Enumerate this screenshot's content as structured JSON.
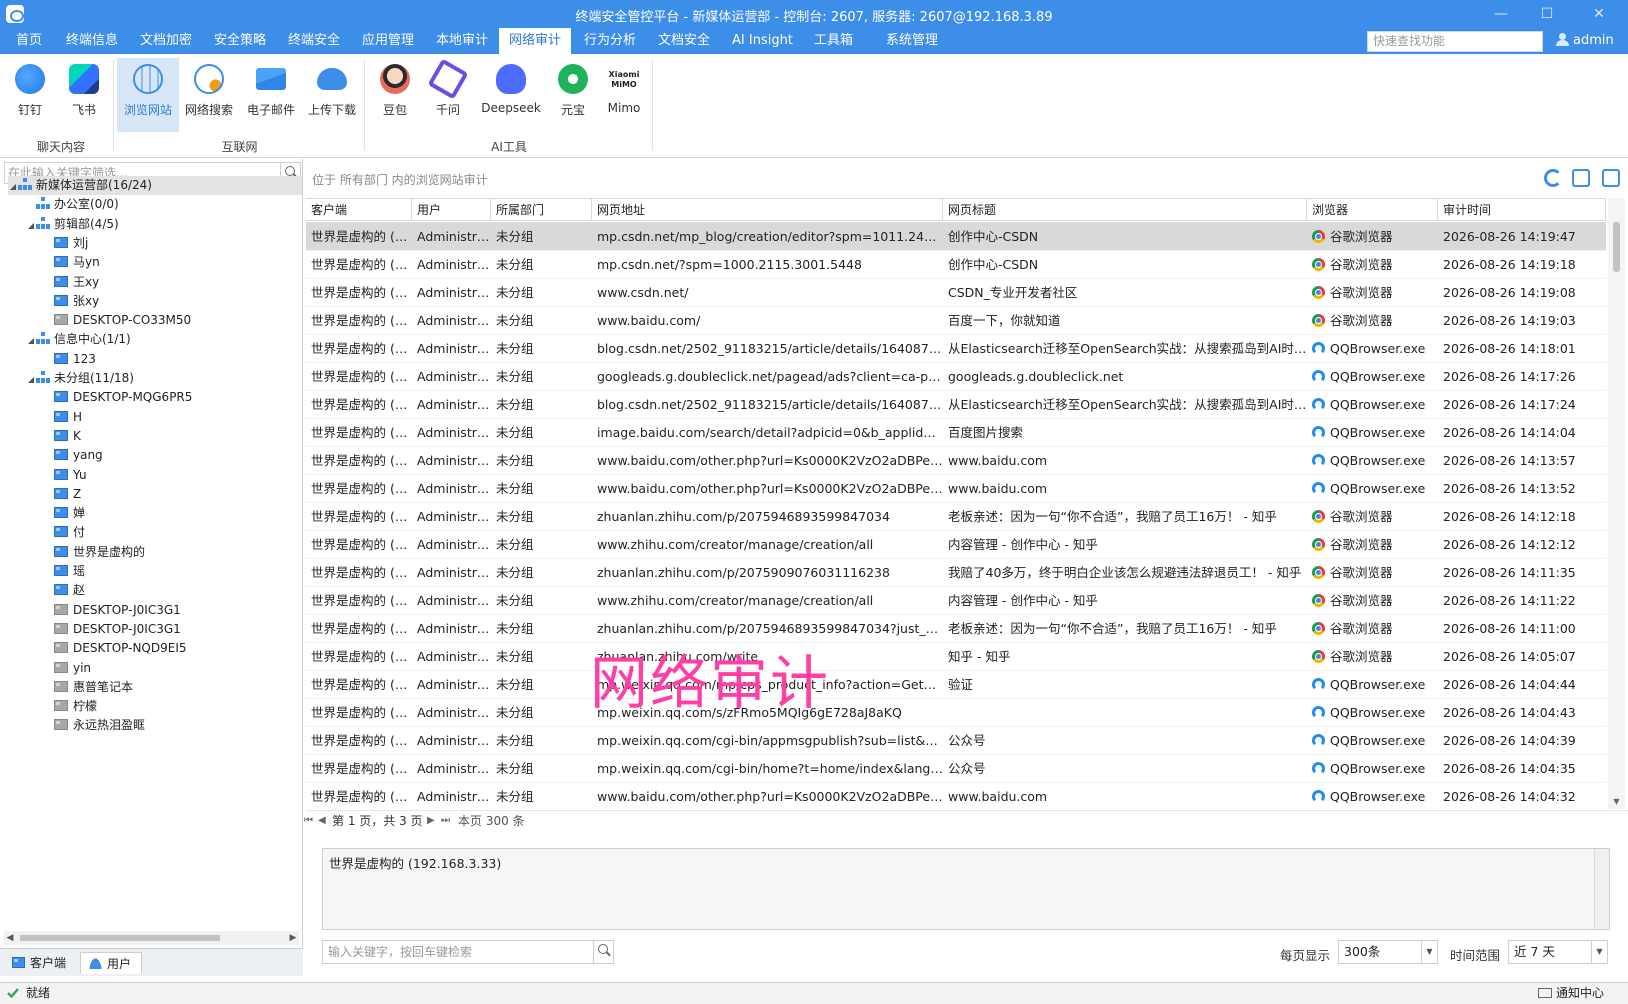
{
  "window": {
    "title": "终端安全管控平台 - 新媒体运营部 - 控制台: 2607, 服务器: 2607@192.168.3.89",
    "minimize": "—",
    "maximize": "☐",
    "close": "✕"
  },
  "menu": {
    "items": [
      "首页",
      "终端信息",
      "文档加密",
      "安全策略",
      "终端安全",
      "应用管理",
      "本地审计",
      "网络审计",
      "行为分析",
      "文档安全",
      "AI Insight",
      "工具箱",
      "系统管理"
    ],
    "active_index": 7,
    "quick_search_placeholder": "快速查找功能",
    "user": "admin"
  },
  "ribbon": {
    "groups": [
      {
        "label": "聊天内容",
        "buttons": [
          "钉钉",
          "飞书"
        ]
      },
      {
        "label": "互联网",
        "buttons": [
          "浏览网站",
          "网络搜索",
          "电子邮件",
          "上传下载"
        ]
      },
      {
        "label": "AI工具",
        "buttons": [
          "豆包",
          "千问",
          "Deepseek",
          "元宝",
          "Mimo"
        ]
      }
    ],
    "active_button": "浏览网站",
    "mimo_logo_text": [
      "Xiaomi",
      "MiMO"
    ]
  },
  "tree": {
    "filter_placeholder": "在此输入关键字筛选...",
    "nodes": [
      {
        "label": "新媒体运营部(16/24)",
        "type": "org",
        "level": 0,
        "expanded": true,
        "selected": true
      },
      {
        "label": "办公室(0/0)",
        "type": "org",
        "level": 1
      },
      {
        "label": "剪辑部(4/5)",
        "type": "org",
        "level": 1,
        "expanded": true
      },
      {
        "label": "刘j",
        "type": "pc",
        "level": 2
      },
      {
        "label": "马yn",
        "type": "pc",
        "level": 2
      },
      {
        "label": "王xy",
        "type": "pc",
        "level": 2
      },
      {
        "label": "张xy",
        "type": "pc",
        "level": 2
      },
      {
        "label": "DESKTOP-CO33M50",
        "type": "pc-off",
        "level": 2
      },
      {
        "label": "信息中心(1/1)",
        "type": "org",
        "level": 1,
        "expanded": true
      },
      {
        "label": "123",
        "type": "pc",
        "level": 2
      },
      {
        "label": "未分组(11/18)",
        "type": "org",
        "level": 1,
        "expanded": true
      },
      {
        "label": "DESKTOP-MQG6PR5",
        "type": "pc",
        "level": 2
      },
      {
        "label": "H",
        "type": "pc",
        "level": 2
      },
      {
        "label": "K",
        "type": "pc",
        "level": 2
      },
      {
        "label": "yang",
        "type": "pc",
        "level": 2
      },
      {
        "label": "Yu",
        "type": "pc",
        "level": 2
      },
      {
        "label": "Z",
        "type": "pc",
        "level": 2
      },
      {
        "label": "婵",
        "type": "pc",
        "level": 2
      },
      {
        "label": "付",
        "type": "pc",
        "level": 2
      },
      {
        "label": "世界是虚构的",
        "type": "pc",
        "level": 2
      },
      {
        "label": "瑶",
        "type": "pc",
        "level": 2
      },
      {
        "label": "赵",
        "type": "pc",
        "level": 2
      },
      {
        "label": "DESKTOP-J0IC3G1",
        "type": "pc-off",
        "level": 2
      },
      {
        "label": "DESKTOP-J0IC3G1",
        "type": "pc-off",
        "level": 2
      },
      {
        "label": "DESKTOP-NQD9EI5",
        "type": "pc-off",
        "level": 2
      },
      {
        "label": "yin",
        "type": "pc-off",
        "level": 2
      },
      {
        "label": "惠普笔记本",
        "type": "pc-off",
        "level": 2
      },
      {
        "label": "柠檬",
        "type": "pc-off",
        "level": 2
      },
      {
        "label": "永远热泪盈眶",
        "type": "pc-off",
        "level": 2
      }
    ],
    "tabs": [
      "客户端",
      "用户"
    ],
    "active_tab": "用户"
  },
  "main": {
    "info": "位于 所有部门 内的浏览网站审计",
    "columns": [
      "客户端",
      "用户",
      "所属部门",
      "网页地址",
      "网页标题",
      "浏览器",
      "审计时间"
    ],
    "rows": [
      [
        "世界是虚构的 (1...",
        "Administra...",
        "未分组",
        "mp.csdn.net/mp_blog/creation/editor?spm=1011.2415.300...",
        "创作中心-CSDN",
        "谷歌浏览器",
        "2026-08-26 14:19:47"
      ],
      [
        "世界是虚构的 (1...",
        "Administra...",
        "未分组",
        "mp.csdn.net/?spm=1000.2115.3001.5448",
        "创作中心-CSDN",
        "谷歌浏览器",
        "2026-08-26 14:19:18"
      ],
      [
        "世界是虚构的 (1...",
        "Administra...",
        "未分组",
        "www.csdn.net/",
        "CSDN_专业开发者社区",
        "谷歌浏览器",
        "2026-08-26 14:19:08"
      ],
      [
        "世界是虚构的 (1...",
        "Administra...",
        "未分组",
        "www.baidu.com/",
        "百度一下，你就知道",
        "谷歌浏览器",
        "2026-08-26 14:19:03"
      ],
      [
        "世界是虚构的 (1...",
        "Administra...",
        "未分组",
        "blog.csdn.net/2502_91183215/article/details/164087320?sh...",
        "从Elasticsearch迁移至OpenSearch实战：从搜索孤岛到AI时代的...",
        "QQBrowser.exe",
        "2026-08-26 14:18:01"
      ],
      [
        "世界是虚构的 (1...",
        "Administra...",
        "未分组",
        "googleads.g.doubleclick.net/pagead/ads?client=ca-pub-10...",
        "googleads.g.doubleclick.net",
        "QQBrowser.exe",
        "2026-08-26 14:17:26"
      ],
      [
        "世界是虚构的 (1...",
        "Administra...",
        "未分组",
        "blog.csdn.net/2502_91183215/article/details/164087320?sh...",
        "从Elasticsearch迁移至OpenSearch实战：从搜索孤岛到AI时代的...",
        "QQBrowser.exe",
        "2026-08-26 14:17:24"
      ],
      [
        "世界是虚构的 (1...",
        "Administra...",
        "未分组",
        "image.baidu.com/search/detail?adpicid=0&b_applid=9215...",
        "百度图片搜索",
        "QQBrowser.exe",
        "2026-08-26 14:14:04"
      ],
      [
        "世界是虚构的 (1...",
        "Administra...",
        "未分组",
        "www.baidu.com/other.php?url=Ks0000K2VzO2aDBPeB2uGZ...",
        "www.baidu.com",
        "QQBrowser.exe",
        "2026-08-26 14:13:57"
      ],
      [
        "世界是虚构的 (1...",
        "Administra...",
        "未分组",
        "www.baidu.com/other.php?url=Ks0000K2VzO2aDBPeB2uGZ...",
        "www.baidu.com",
        "QQBrowser.exe",
        "2026-08-26 14:13:52"
      ],
      [
        "世界是虚构的 (1...",
        "Administra...",
        "未分组",
        "zhuanlan.zhihu.com/p/2075946893599847034",
        "老板亲述：因为一句“你不合适”，我赔了员工16万！ - 知乎",
        "谷歌浏览器",
        "2026-08-26 14:12:18"
      ],
      [
        "世界是虚构的 (1...",
        "Administra...",
        "未分组",
        "www.zhihu.com/creator/manage/creation/all",
        "内容管理 - 创作中心 - 知乎",
        "谷歌浏览器",
        "2026-08-26 14:12:12"
      ],
      [
        "世界是虚构的 (1...",
        "Administra...",
        "未分组",
        "zhuanlan.zhihu.com/p/2075909076031116238",
        "我赔了40多万，终于明白企业该怎么规避违法辞退员工！ - 知乎",
        "谷歌浏览器",
        "2026-08-26 14:11:35"
      ],
      [
        "世界是虚构的 (1...",
        "Administra...",
        "未分组",
        "www.zhihu.com/creator/manage/creation/all",
        "内容管理 - 创作中心 - 知乎",
        "谷歌浏览器",
        "2026-08-26 14:11:22"
      ],
      [
        "世界是虚构的 (1...",
        "Administra...",
        "未分组",
        "zhuanlan.zhihu.com/p/2075946893599847034?just_publishe...",
        "老板亲述：因为一句“你不合适”，我赔了员工16万！ - 知乎",
        "谷歌浏览器",
        "2026-08-26 14:11:00"
      ],
      [
        "世界是虚构的 (1...",
        "Administra...",
        "未分组",
        "zhuanlan.zhihu.com/write",
        "知乎 - 知乎",
        "谷歌浏览器",
        "2026-08-26 14:05:07"
      ],
      [
        "世界是虚构的 (1...",
        "Administra...",
        "未分组",
        "mp.weixin.qq.com/mp/cps_product_info?action=GetCpsVer...",
        "验证",
        "QQBrowser.exe",
        "2026-08-26 14:04:44"
      ],
      [
        "世界是虚构的 (1...",
        "Administra...",
        "未分组",
        "mp.weixin.qq.com/s/zFRmo5MQIg6gE728aJ8aKQ",
        "",
        "QQBrowser.exe",
        "2026-08-26 14:04:43"
      ],
      [
        "世界是虚构的 (1...",
        "Administra...",
        "未分组",
        "mp.weixin.qq.com/cgi-bin/appmsgpublish?sub=list&begin...",
        "公众号",
        "QQBrowser.exe",
        "2026-08-26 14:04:39"
      ],
      [
        "世界是虚构的 (1...",
        "Administra...",
        "未分组",
        "mp.weixin.qq.com/cgi-bin/home?t=home/index&lang=zh_...",
        "公众号",
        "QQBrowser.exe",
        "2026-08-26 14:04:35"
      ],
      [
        "世界是虚构的 (1...",
        "Administra...",
        "未分组",
        "www.baidu.com/other.php?url=Ks0000K2VzO2aDBPeB2uGZ...",
        "www.baidu.com",
        "QQBrowser.exe",
        "2026-08-26 14:04:32"
      ]
    ],
    "pager": {
      "page_text": "第 1 页，共 3 页",
      "count_text": "本页 300 条"
    },
    "detail": "世界是虚构的 (192.168.3.33)",
    "search_placeholder": "输入关键字，按回车键检索",
    "per_page_label": "每页显示",
    "per_page_value": "300条",
    "range_label": "时间范围",
    "range_value": "近 7 天",
    "watermark": "网络审计"
  },
  "status": {
    "text": "就绪",
    "notice": "通知中心"
  },
  "colors": {
    "accent": "#3d8ee8",
    "watermark": "#ff3fa4"
  }
}
